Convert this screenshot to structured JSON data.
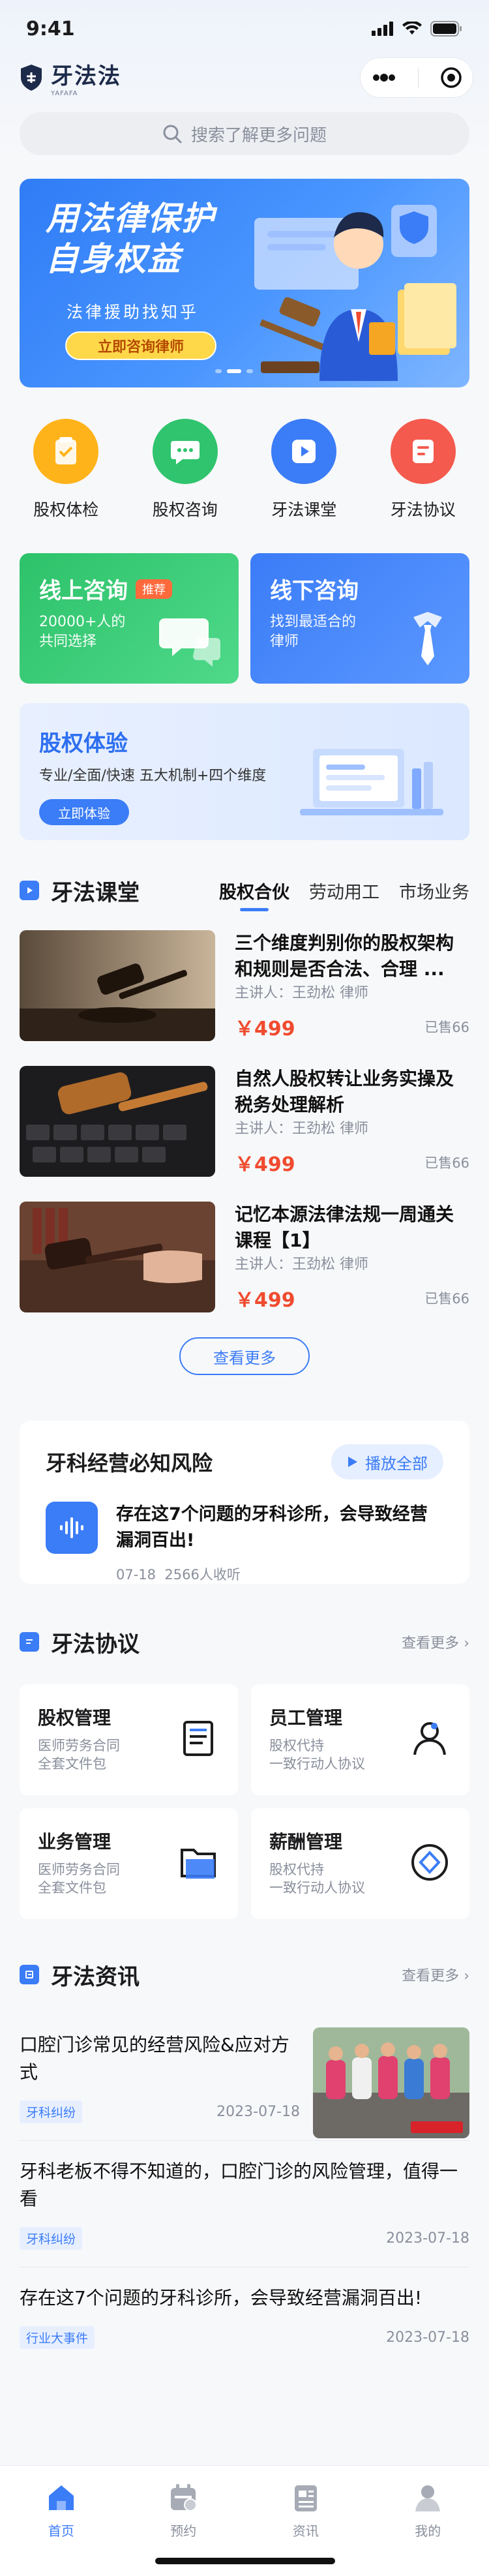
{
  "status_bar": {
    "time": "9:41"
  },
  "header": {
    "brand": "牙法法",
    "brand_sub": "YAFAFA"
  },
  "search": {
    "placeholder": "搜索了解更多问题"
  },
  "banner": {
    "title_line1": "用法律保护",
    "title_line2": "自身权益",
    "subtitle": "法律援助找知乎",
    "cta": "立即咨询律师",
    "slide_count": 3,
    "active_slide": 1
  },
  "quick_entries": [
    {
      "label": "股权体检",
      "icon": "health-check-icon",
      "color": "#ffb31a"
    },
    {
      "label": "股权咨询",
      "icon": "chat-bubble-icon",
      "color": "#2fc46d"
    },
    {
      "label": "牙法课堂",
      "icon": "video-play-icon",
      "color": "#3b7cf7"
    },
    {
      "label": "牙法协议",
      "icon": "document-icon",
      "color": "#f45a4d"
    }
  ],
  "consult": {
    "online": {
      "title": "线上咨询",
      "tag": "推荐",
      "desc_line1": "20000+人的",
      "desc_line2": "共同选择"
    },
    "offline": {
      "title": "线下咨询",
      "desc_line1": "找到最适合的",
      "desc_line2": "律师"
    }
  },
  "experience": {
    "title": "股权体验",
    "desc": "专业/全面/快速  五大机制+四个维度",
    "button": "立即体验"
  },
  "classroom": {
    "title": "牙法课堂",
    "tabs": [
      "股权合伙",
      "劳动用工",
      "市场业务"
    ],
    "active_tab": 0,
    "courses": [
      {
        "title": "三个维度判别你的股权架构和规则是否合法、合理 ...",
        "lecturer": "主讲人：王劲松 律师",
        "price": "￥499",
        "sold": "已售66"
      },
      {
        "title": "自然人股权转让业务实操及税务处理解析",
        "lecturer": "主讲人：王劲松 律师",
        "price": "￥499",
        "sold": "已售66"
      },
      {
        "title": "记忆本源法律法规一周通关课程【1】",
        "lecturer": "主讲人：王劲松 律师",
        "price": "￥499",
        "sold": "已售66"
      }
    ],
    "see_more": "查看更多"
  },
  "risk": {
    "title": "牙科经营必知风险",
    "play_all": "播放全部",
    "audio_title": "存在这7个问题的牙科诊所，会导致经营漏洞百出!",
    "date": "07-18",
    "listens": "2566人收听"
  },
  "agreement": {
    "title": "牙法协议",
    "more": "查看更多",
    "items": [
      {
        "title": "股权管理",
        "line1": "医师劳务合同",
        "line2": "全套文件包",
        "icon": "book-icon"
      },
      {
        "title": "员工管理",
        "line1": "股权代持",
        "line2": "一致行动人协议",
        "icon": "user-icon"
      },
      {
        "title": "业务管理",
        "line1": "医师劳务合同",
        "line2": "全套文件包",
        "icon": "folder-icon"
      },
      {
        "title": "薪酬管理",
        "line1": "股权代持",
        "line2": "一致行动人协议",
        "icon": "diamond-icon"
      }
    ]
  },
  "news": {
    "title": "牙法资讯",
    "more": "查看更多",
    "items": [
      {
        "title": "口腔门诊常见的经营风险&应对方式",
        "tag": "牙科纠纷",
        "date": "2023-07-18",
        "image": "marathon-photo"
      },
      {
        "title": "牙科老板不得不知道的，口腔门诊的风险管理，值得一看",
        "tag": "牙科纠纷",
        "date": "2023-07-18"
      },
      {
        "title": "存在这7个问题的牙科诊所，会导致经营漏洞百出!",
        "tag": "行业大事件",
        "date": "2023-07-18"
      }
    ]
  },
  "tabbar": [
    {
      "label": "首页",
      "icon": "home-icon",
      "active": true
    },
    {
      "label": "预约",
      "icon": "calendar-icon",
      "active": false
    },
    {
      "label": "资讯",
      "icon": "news-icon",
      "active": false
    },
    {
      "label": "我的",
      "icon": "profile-icon",
      "active": false
    }
  ],
  "colors": {
    "primary": "#3b7cf7",
    "price": "#f04b2f",
    "green": "#2fc46d"
  }
}
